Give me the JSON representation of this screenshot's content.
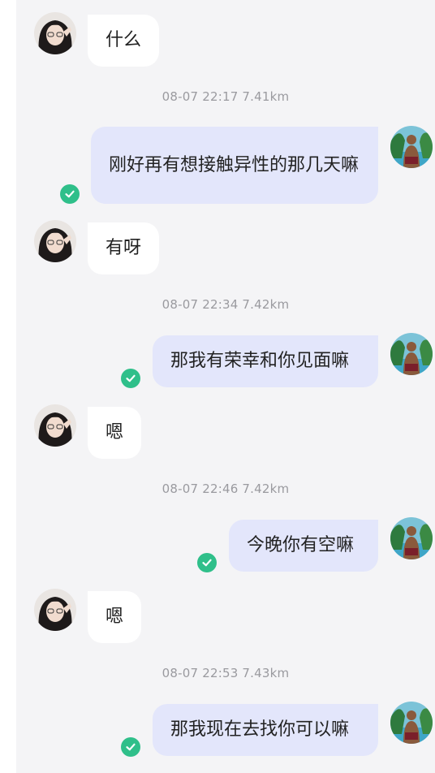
{
  "conversation": {
    "messages": [
      {
        "side": "in",
        "text": "什么"
      },
      {
        "timestamp": "08-07 22:17",
        "distance": "7.41km"
      },
      {
        "side": "out",
        "text": "刚好再有想接触异性的那几天嘛",
        "status": "read"
      },
      {
        "side": "in",
        "text": "有呀"
      },
      {
        "timestamp": "08-07 22:34",
        "distance": "7.42km"
      },
      {
        "side": "out",
        "text": "那我有荣幸和你见面嘛",
        "status": "read"
      },
      {
        "side": "in",
        "text": "嗯"
      },
      {
        "timestamp": "08-07 22:46",
        "distance": "7.42km"
      },
      {
        "side": "out",
        "text": "今晚你有空嘛",
        "status": "read"
      },
      {
        "side": "in",
        "text": "嗯"
      },
      {
        "timestamp": "08-07 22:53",
        "distance": "7.43km"
      },
      {
        "side": "out",
        "text": "那我现在去找你可以嘛",
        "status": "read"
      }
    ]
  },
  "icons": {
    "read_receipt": "check-circle-icon",
    "contact_avatar": "female-avatar",
    "self_avatar": "male-avatar"
  },
  "colors": {
    "background": "#f4f4f6",
    "incoming_bubble": "#ffffff",
    "outgoing_bubble": "#e3e6fb",
    "read_check": "#2fbf8a",
    "timestamp": "#9a9a9f"
  }
}
